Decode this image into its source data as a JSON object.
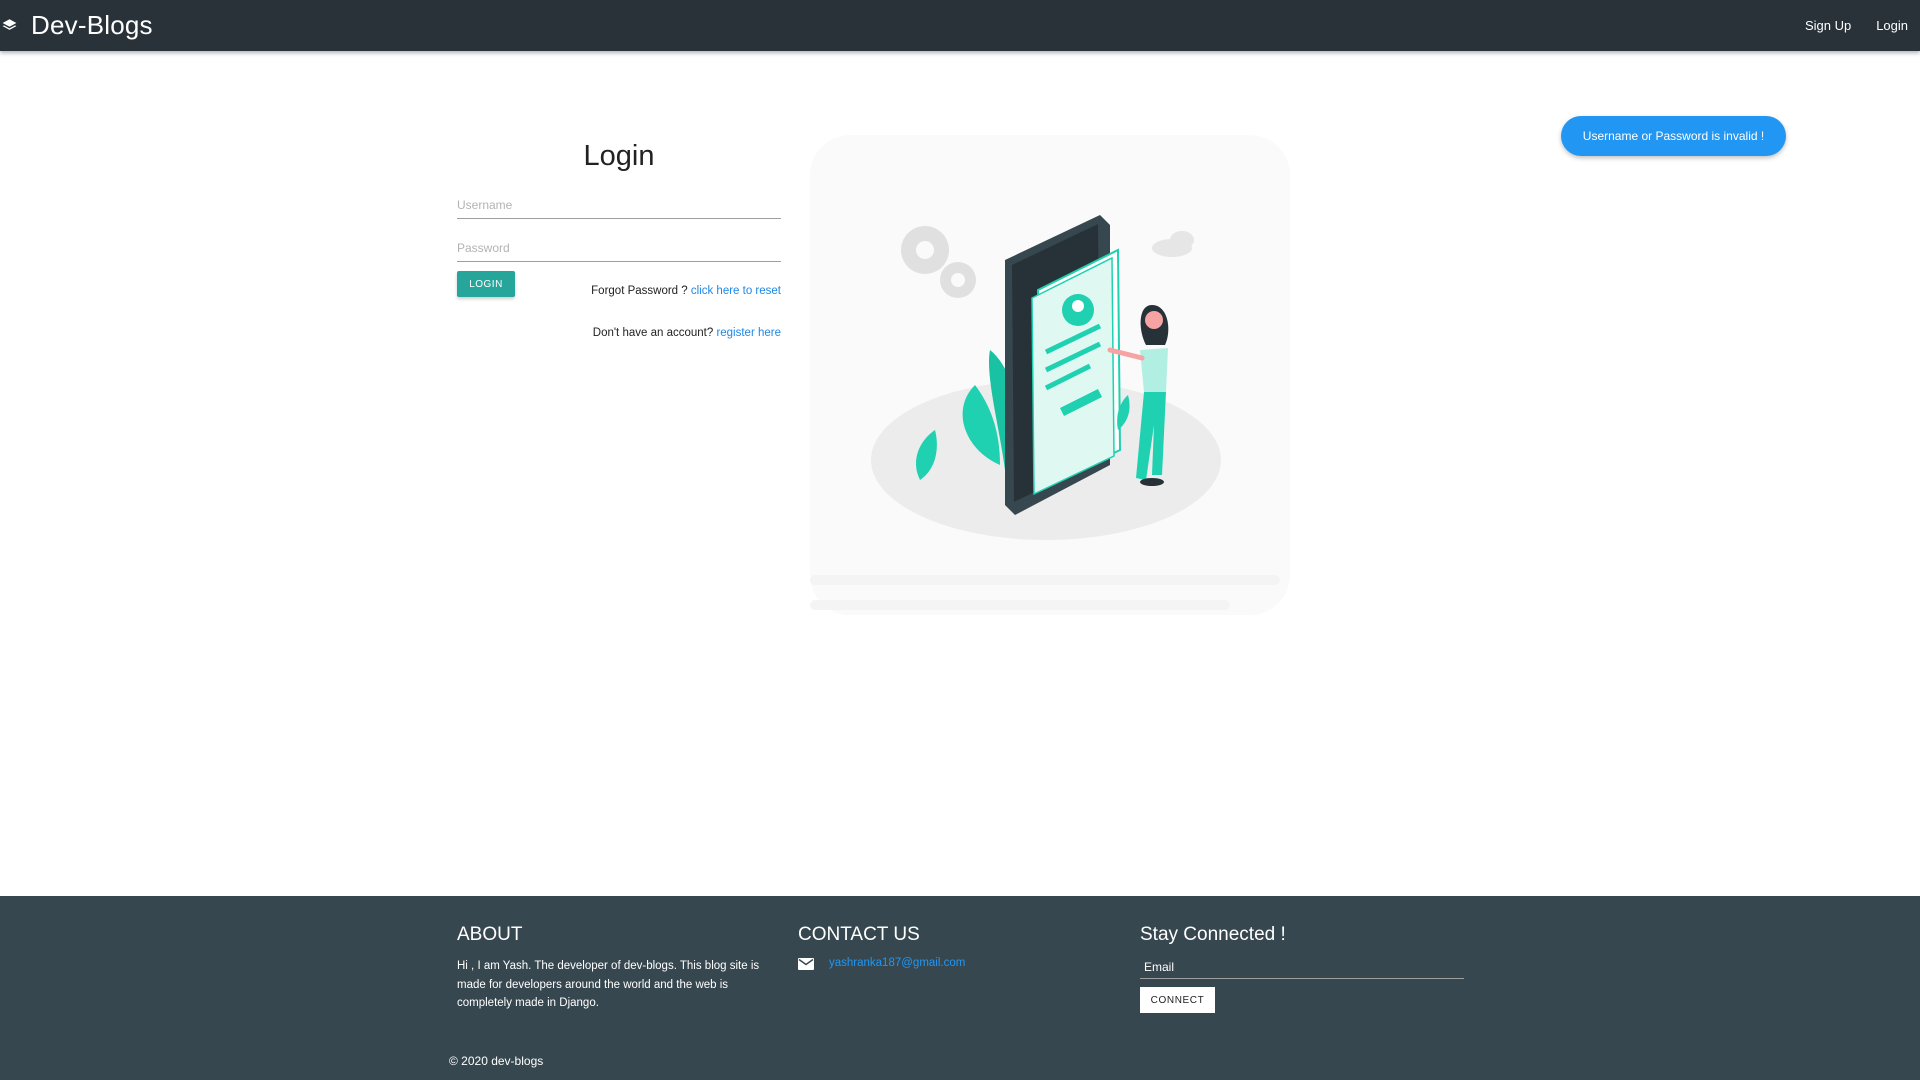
{
  "navbar": {
    "brand_icon": "layers-icon",
    "brand": "Dev-Blogs",
    "links": [
      "Sign Up",
      "Login"
    ]
  },
  "login": {
    "title": "Login",
    "username_placeholder": "Username",
    "password_placeholder": "Password",
    "button": "LOGIN",
    "forgot_text": "Forgot Password ? ",
    "forgot_link": "click here to reset",
    "register_text": "Don't have an account? ",
    "register_link": "register here"
  },
  "toast": {
    "message": "Username or Password is invalid !"
  },
  "footer": {
    "about": {
      "title": "ABOUT",
      "text": "Hi , I am Yash. The developer of dev-blogs. This blog site is made for developers around the world and the web is completely made in Django."
    },
    "contact": {
      "title": "CONTACT US",
      "icon": "mail-icon",
      "email": "yashranka187@gmail.com"
    },
    "stay": {
      "title": "Stay Connected !",
      "email_placeholder": "Email",
      "button": "CONNECT"
    },
    "copyright": "© 2020 dev-blogs"
  },
  "colors": {
    "navbar": "#283238",
    "footer": "#37474f",
    "accent_teal": "#26a69a",
    "illustration_teal": "#1fd1b0",
    "link_blue": "#1e88e5",
    "toast_blue": "#2196f3"
  }
}
